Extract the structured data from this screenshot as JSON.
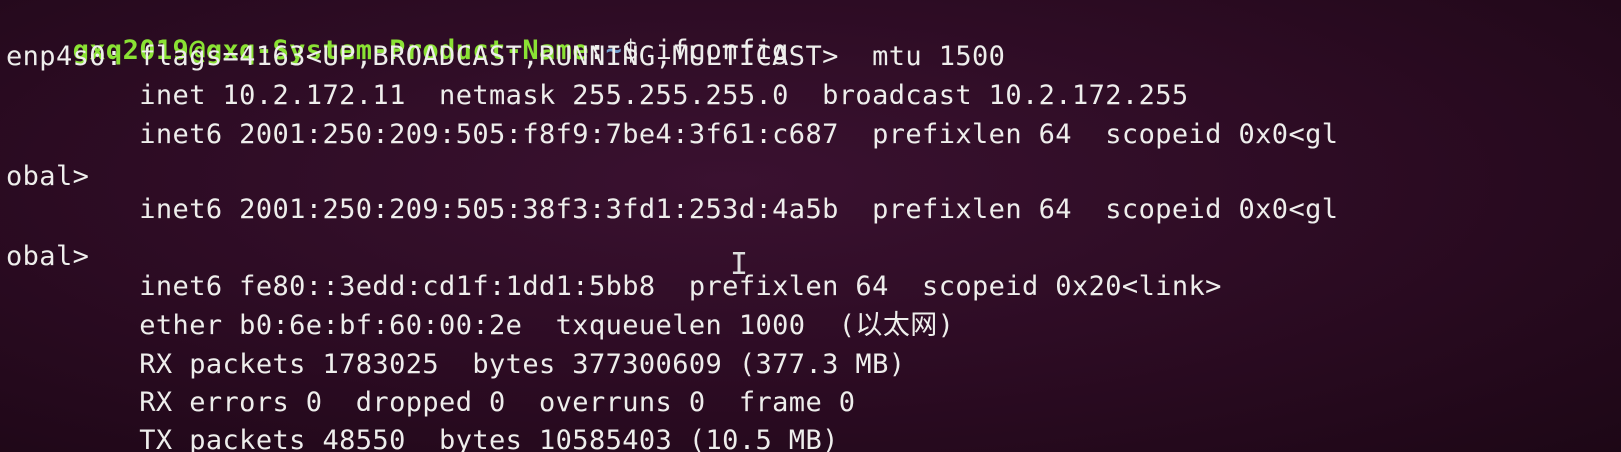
{
  "terminal": {
    "prompt_user_host": "gxq2019@gxq-System-Product-Name",
    "prompt_sep": ":",
    "prompt_path": "~",
    "prompt_symbol": "$ ",
    "command": "ifconfig",
    "lines": [
      "enp4s0: flags=4163<UP,BROADCAST,RUNNING,MULTICAST>  mtu 1500",
      "        inet 10.2.172.11  netmask 255.255.255.0  broadcast 10.2.172.255",
      "        inet6 2001:250:209:505:f8f9:7be4:3f61:c687  prefixlen 64  scopeid 0x0<gl",
      "obal>",
      "        inet6 2001:250:209:505:38f3:3fd1:253d:4a5b  prefixlen 64  scopeid 0x0<gl",
      "obal>",
      "        inet6 fe80::3edd:cd1f:1dd1:5bb8  prefixlen 64  scopeid 0x20<link>",
      "        ether b0:6e:bf:60:00:2e  txqueuelen 1000  (以太网)",
      "        RX packets 1783025  bytes 377300609 (377.3 MB)",
      "        RX errors 0  dropped 0  overruns 0  frame 0",
      "        TX packets 48550  bytes 10585403 (10.5 MB)"
    ],
    "cursor_glyph": "I"
  }
}
